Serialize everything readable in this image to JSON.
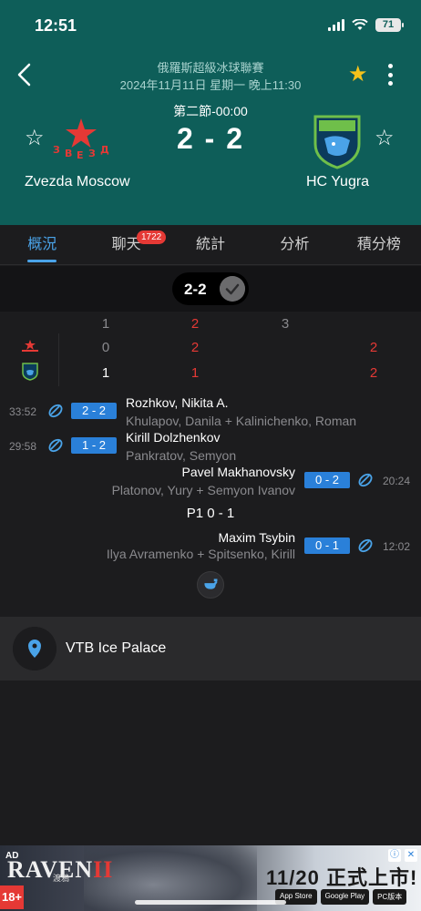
{
  "status": {
    "time": "12:51",
    "battery": "71"
  },
  "header": {
    "league": "俄羅斯超級冰球聯賽",
    "datetime": "2024年11月11日 星期一 晚上11:30",
    "period_status": "第二節-00:00",
    "score": "2 - 2",
    "home_team": "Zvezda Moscow",
    "away_team": "HC Yugra",
    "favorite_color": "#f5c21b"
  },
  "tabs": [
    {
      "label": "概況",
      "active": true
    },
    {
      "label": "聊天",
      "badge": "1722"
    },
    {
      "label": "統計"
    },
    {
      "label": "分析"
    },
    {
      "label": "積分榜"
    }
  ],
  "summary_pill": {
    "score": "2-2"
  },
  "period_table": {
    "headers": [
      "1",
      "2",
      "3"
    ],
    "home": {
      "p1": "0",
      "p2": "2",
      "total": "2"
    },
    "away": {
      "p1": "1",
      "p2": "1",
      "total": "2"
    }
  },
  "events": [
    {
      "time": "33:52",
      "score": "2 - 2",
      "scorer": "Rozhkov, Nikita A.",
      "assist": "Khulapov, Danila + Kalinichenko, Roman",
      "side": "home"
    },
    {
      "time": "29:58",
      "score": "1 - 2",
      "scorer": "Kirill Dolzhenkov",
      "assist": "Pankratov, Semyon",
      "side": "home"
    },
    {
      "time": "20:24",
      "score": "0 - 2",
      "scorer": "Pavel Makhanovsky",
      "assist": "Platonov, Yury + Semyon Ivanov",
      "side": "away"
    },
    {
      "time": "12:02",
      "score": "0 - 1",
      "scorer": "Maxim Tsybin",
      "assist": "Ilya Avramenko + Spitsenko, Kirill",
      "side": "away"
    }
  ],
  "period_label": "P1 0 - 1",
  "venue": {
    "name": "VTB Ice Palace"
  },
  "ad": {
    "label": "AD",
    "logo_text": "RAVEN",
    "logo_roman": "II",
    "logo_sub": "渡鴉",
    "age": "18+",
    "headline": "11/20 正式上市!",
    "stores": [
      "App Store",
      "Google Play",
      "PC版本"
    ]
  },
  "colors": {
    "header_bg": "#0e5e59",
    "accent": "#4aa3e8",
    "goal_badge": "#2a80d9",
    "highlight": "#e53935"
  }
}
